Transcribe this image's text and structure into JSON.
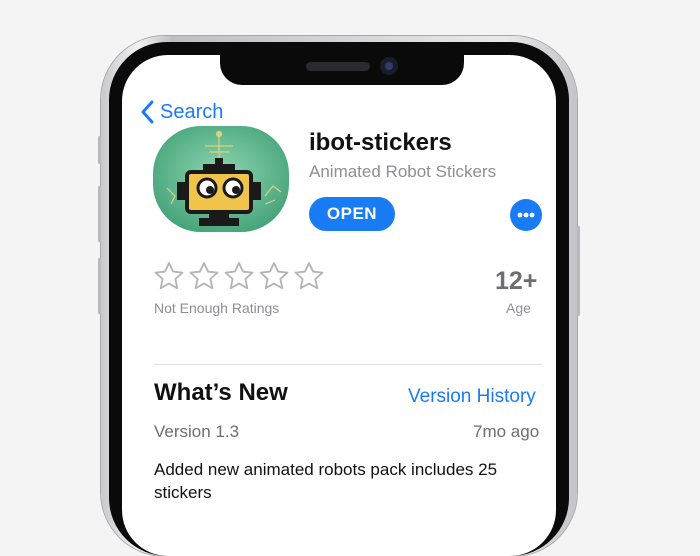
{
  "nav": {
    "back_label": "Search"
  },
  "app": {
    "name": "ibot-stickers",
    "subtitle": "Animated Robot Stickers",
    "open_label": "OPEN",
    "icon": "robot-app-icon",
    "accent_color": "#1a7cf4",
    "icon_bg_color": "#5bb88c"
  },
  "rating": {
    "stars_filled": 0,
    "stars_total": 5,
    "label": "Not Enough Ratings"
  },
  "age": {
    "value": "12+",
    "label": "Age"
  },
  "whats_new": {
    "heading": "What’s New",
    "history_link": "Version History",
    "version": "Version 1.3",
    "time_ago": "7mo ago",
    "notes": "Added new animated robots pack includes 25 stickers"
  }
}
